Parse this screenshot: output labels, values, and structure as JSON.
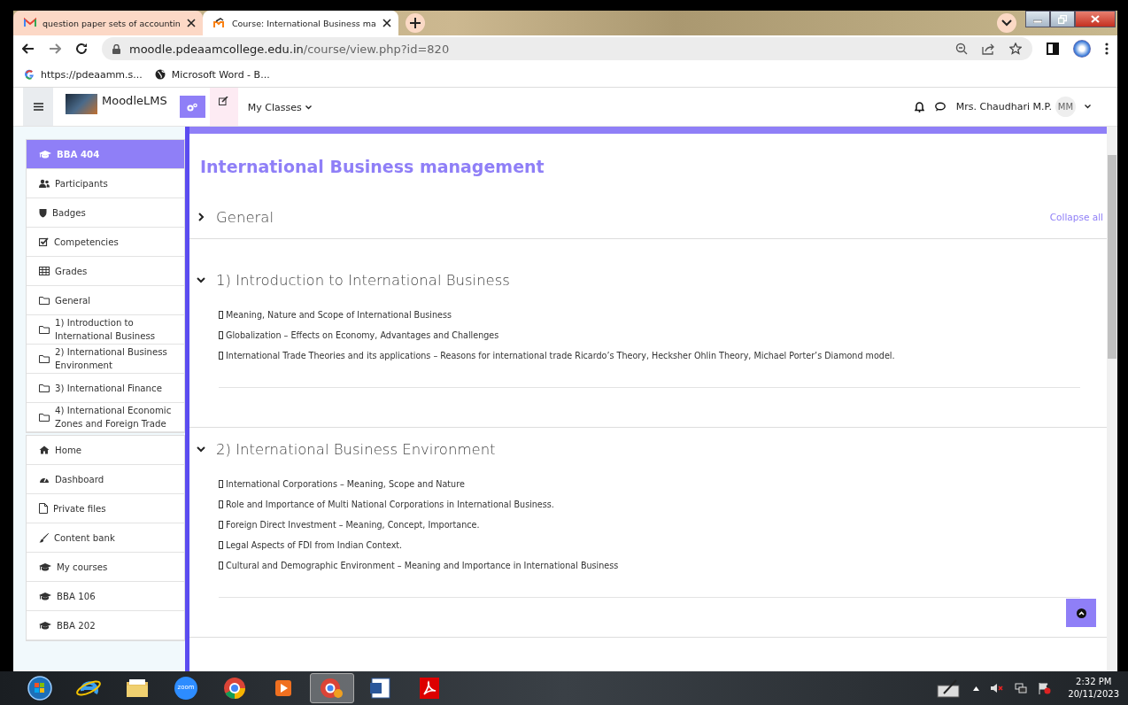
{
  "browser": {
    "tabs": [
      {
        "title": "question paper sets of accountin",
        "kind": "gmail",
        "selected": false
      },
      {
        "title": "Course: International Business ma",
        "kind": "moodle",
        "selected": true
      }
    ],
    "url_host": "moodle.pdeaamcollege.edu.in",
    "url_path": "/course/view.php?id=820",
    "bookmarks": [
      {
        "label": "https://pdeaamm.s...",
        "kind": "google"
      },
      {
        "label": "Microsoft Word - B...",
        "kind": "globe"
      }
    ]
  },
  "navbar": {
    "site_name": "MoodleLMS",
    "menu": "My Classes",
    "user_name": "Mrs. Chaudhari M.P.",
    "avatar_initials": "MM"
  },
  "sidebar": {
    "blocks": [
      {
        "items": [
          {
            "label": "BBA 404",
            "kind": "course",
            "selected": true
          },
          {
            "label": "Participants",
            "kind": "participants",
            "selected": false
          },
          {
            "label": "Badges",
            "kind": "badges",
            "selected": false
          },
          {
            "label": "Competencies",
            "kind": "competencies",
            "selected": false
          },
          {
            "label": "Grades",
            "kind": "grades",
            "selected": false
          },
          {
            "label": "General",
            "kind": "section",
            "selected": false
          },
          {
            "label": "1) Introduction to International Business",
            "kind": "section",
            "selected": false
          },
          {
            "label": "2) International Business Environment",
            "kind": "section",
            "selected": false
          },
          {
            "label": "3) International Finance",
            "kind": "section",
            "selected": false
          },
          {
            "label": "4) International Economic Zones and Foreign Trade",
            "kind": "section",
            "selected": false
          }
        ]
      },
      {
        "items": [
          {
            "label": "Home",
            "kind": "home",
            "selected": false
          },
          {
            "label": "Dashboard",
            "kind": "dashboard",
            "selected": false
          },
          {
            "label": "Private files",
            "kind": "files",
            "selected": false
          },
          {
            "label": "Content bank",
            "kind": "contentbank",
            "selected": false
          },
          {
            "label": "My courses",
            "kind": "course",
            "selected": false
          },
          {
            "label": "BBA 106",
            "kind": "course",
            "selected": false
          },
          {
            "label": "BBA 202",
            "kind": "course",
            "selected": false
          }
        ]
      }
    ]
  },
  "course": {
    "title": "International Business management",
    "collapse_all": "Collapse all",
    "sections": [
      {
        "title": "General",
        "expanded": false
      },
      {
        "title": "1) Introduction to International Business",
        "expanded": true,
        "items": [
          "Meaning, Nature and Scope of International Business",
          "Globalization – Effects on Economy, Advantages and Challenges",
          "International Trade Theories and its applications – Reasons for international trade Ricardo’s Theory, Hecksher Ohlin Theory, Michael Porter’s Diamond model."
        ]
      },
      {
        "title": "2) International Business Environment",
        "expanded": true,
        "items": [
          "International Corporations – Meaning, Scope and Nature",
          "Role and Importance of Multi National Corporations in International Business.",
          "Foreign Direct Investment – Meaning, Concept, Importance.",
          "Legal Aspects of FDI from Indian Context.",
          "Cultural and Demographic Environment – Meaning and Importance in International Business"
        ]
      }
    ]
  },
  "taskbar": {
    "apps": [
      {
        "kind": "start",
        "selected": false
      },
      {
        "kind": "ie",
        "selected": false
      },
      {
        "kind": "explorer",
        "selected": false
      },
      {
        "kind": "zoom",
        "label": "zoom",
        "selected": false
      },
      {
        "kind": "chrome",
        "selected": false
      },
      {
        "kind": "player",
        "selected": false
      },
      {
        "kind": "chrome-profile",
        "selected": true
      },
      {
        "kind": "word",
        "selected": false
      },
      {
        "kind": "acrobat",
        "selected": false
      }
    ],
    "time": "2:32 PM",
    "date": "20/11/2023"
  }
}
